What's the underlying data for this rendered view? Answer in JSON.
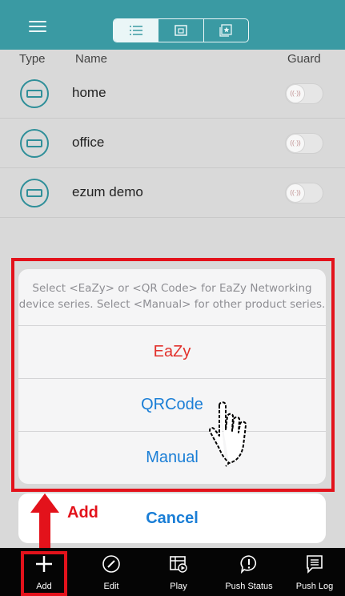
{
  "topbar": {
    "segments": [
      "list-icon",
      "folder-icon",
      "star-folder-icon"
    ]
  },
  "header": {
    "type": "Type",
    "name": "Name",
    "guard": "Guard"
  },
  "devices": [
    {
      "name": "home"
    },
    {
      "name": "office"
    },
    {
      "name": "ezum demo"
    }
  ],
  "action_sheet": {
    "message_line1": "Select <EaZy> or <QR Code> for EaZy Networking",
    "message_line2": "device series. Select <Manual> for other product series.",
    "options": [
      "EaZy",
      "QRCode",
      "Manual"
    ],
    "cancel": "Cancel"
  },
  "annotation": {
    "add_label": "Add",
    "color": "#e3121b"
  },
  "tabbar": {
    "tabs": [
      "Add",
      "Edit",
      "Play",
      "Push Status",
      "Push Log"
    ]
  },
  "colors": {
    "accent": "#3a9aa3",
    "link": "#1a7ed6",
    "destructive": "#e2312c"
  }
}
